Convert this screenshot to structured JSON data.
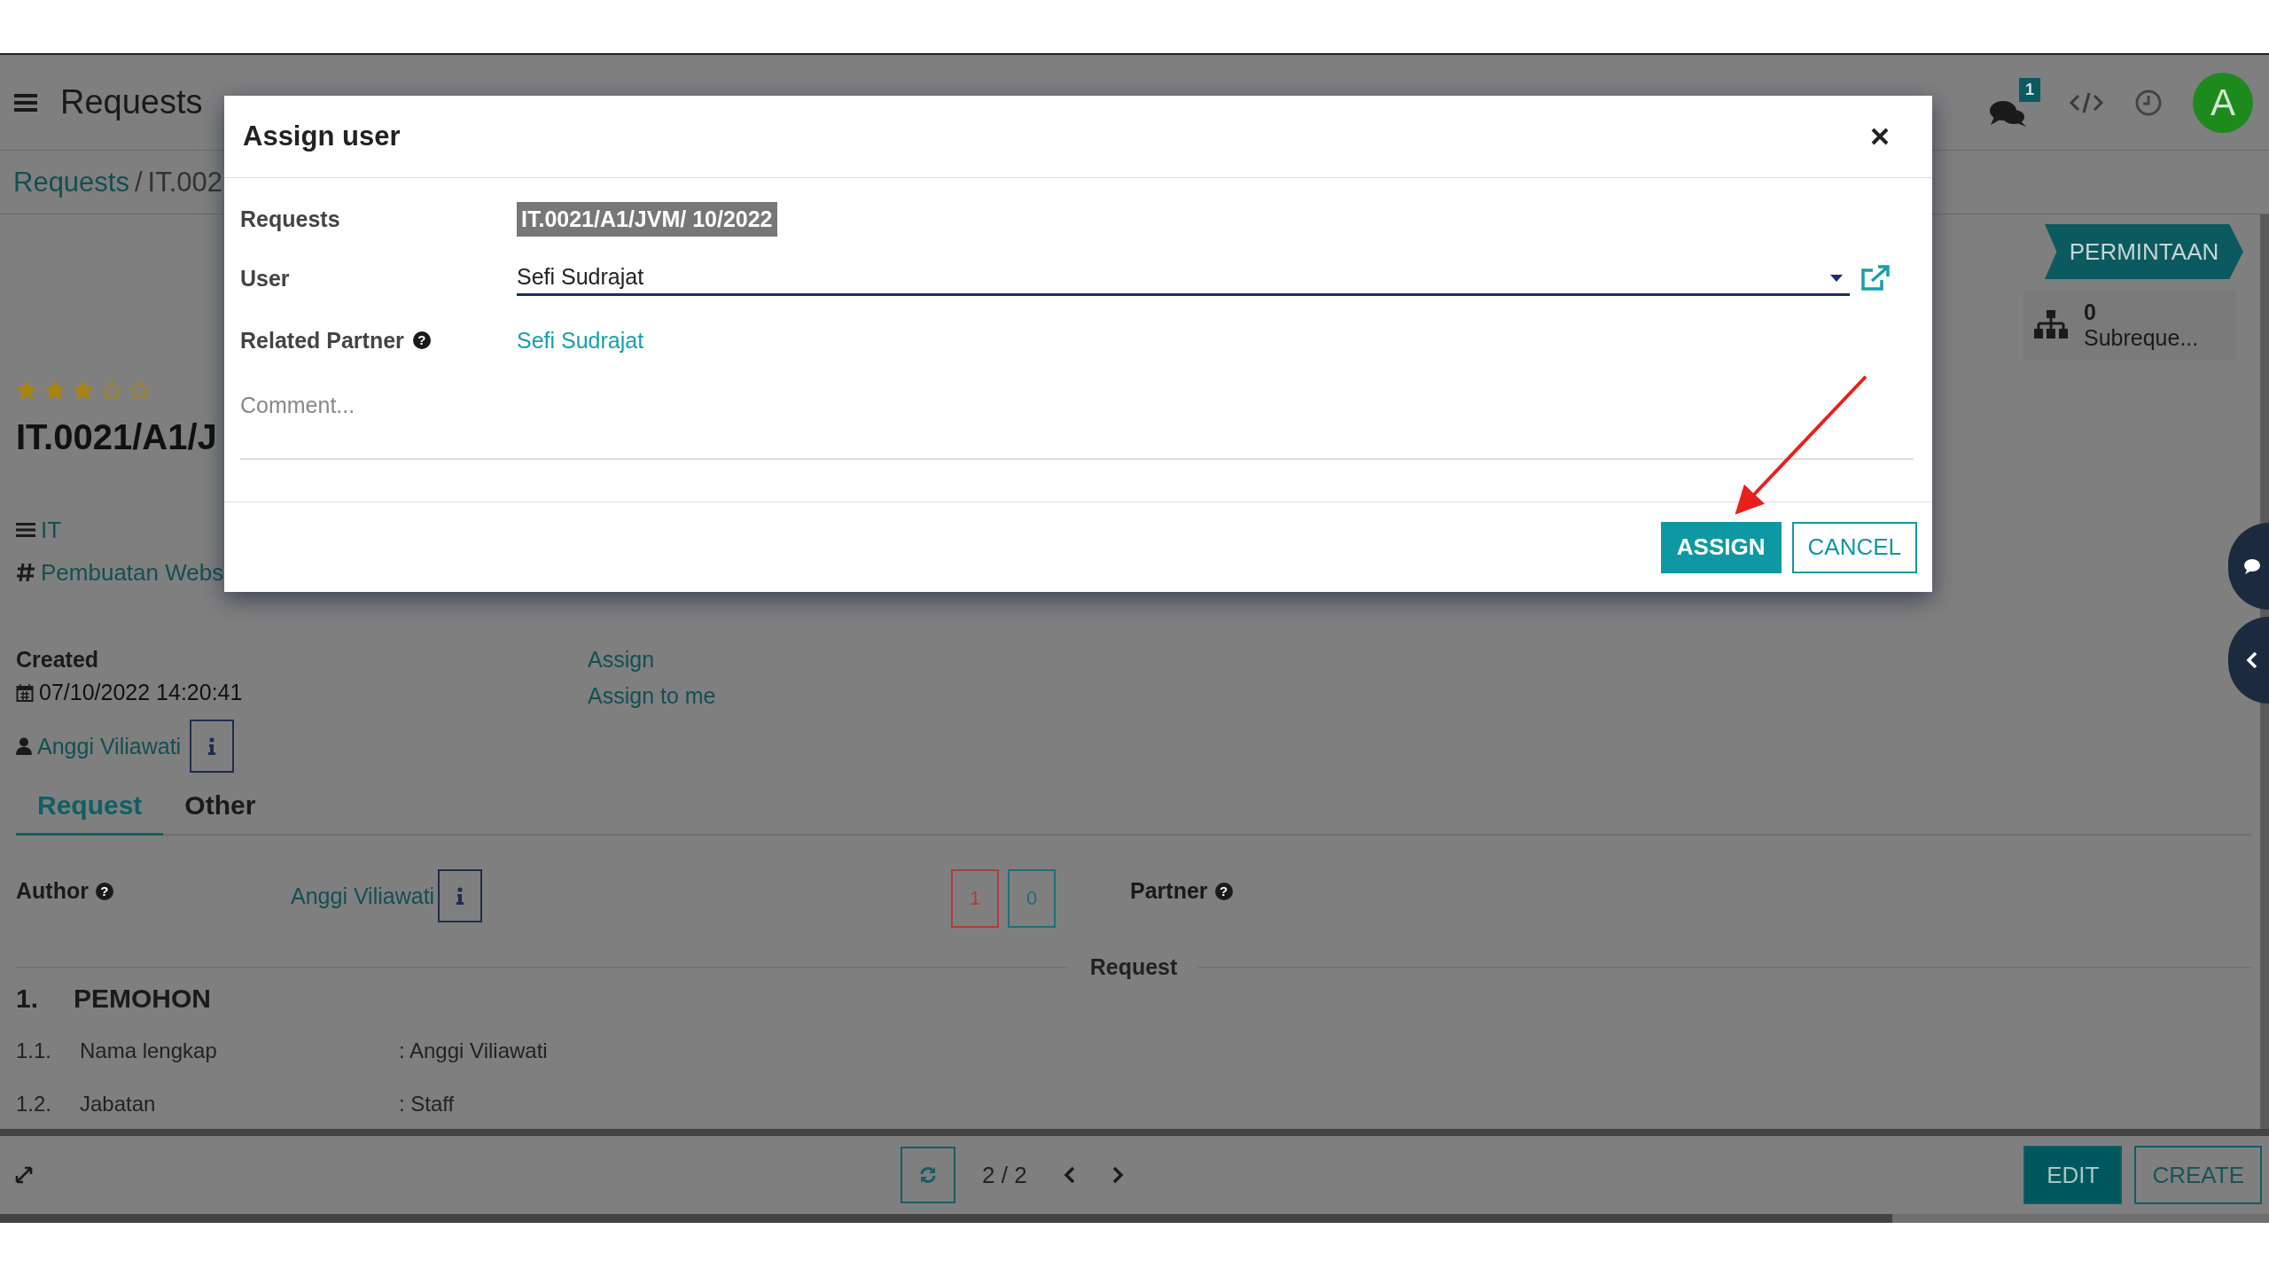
{
  "header": {
    "title": "Requests",
    "notification_count": "1",
    "avatar_letter": "A"
  },
  "breadcrumb": {
    "parent": "Requests",
    "separator": "/",
    "current": "IT.002"
  },
  "status": {
    "label": "PERMINTAAN"
  },
  "smart_button": {
    "count": "0",
    "label": "Subreque..."
  },
  "record": {
    "stars": 3,
    "title": "IT.0021/A1/J",
    "category": "IT",
    "tag": "Pembuatan Webs",
    "created_label": "Created",
    "created": "07/10/2022 14:20:41",
    "user": "Anggi Viliawati",
    "actions": [
      "Assign",
      "Assign to me"
    ]
  },
  "tabs": [
    {
      "label": "Request",
      "selected": true
    },
    {
      "label": "Other",
      "selected": false
    }
  ],
  "author": {
    "label": "Author",
    "help": "?",
    "value": "Anggi Viliawati"
  },
  "counters": [
    {
      "value": "1",
      "color": "#b23a3a"
    },
    {
      "value": "0",
      "color": "#1b7075"
    }
  ],
  "partner": {
    "label": "Partner",
    "help": "?"
  },
  "separator_label": "Request",
  "section": {
    "number": "1.",
    "title": "PEMOHON",
    "rows": [
      {
        "number": "1.1.",
        "label": "Nama lengkap",
        "value": ": Anggi Viliawati"
      },
      {
        "number": "1.2.",
        "label": "Jabatan",
        "value": ": Staff"
      }
    ]
  },
  "pager": {
    "text": "2 / 2"
  },
  "buttons": [
    {
      "label": "EDIT",
      "kind": "primary"
    },
    {
      "label": "CREATE",
      "kind": "secondary"
    }
  ],
  "dialog": {
    "title": "Assign user",
    "fields": [
      {
        "label": "Requests",
        "value": "IT.0021/A1/JVM/ 10/2022",
        "kind": "highlighted"
      },
      {
        "label": "User",
        "value": "Sefi Sudrajat",
        "kind": "input"
      },
      {
        "label": "Related Partner",
        "help": "?",
        "value": "Sefi Sudrajat",
        "kind": "link"
      }
    ],
    "comment": {
      "placeholder": "Comment..."
    },
    "buttons": [
      {
        "label": "ASSIGN",
        "kind": "primary"
      },
      {
        "label": "CANCEL",
        "kind": "secondary"
      }
    ]
  }
}
